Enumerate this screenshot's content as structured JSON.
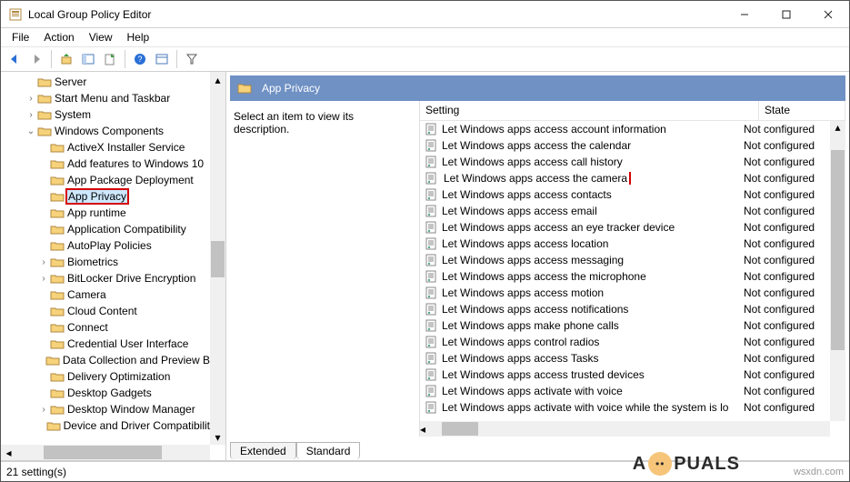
{
  "window": {
    "title": "Local Group Policy Editor"
  },
  "menu": {
    "file": "File",
    "action": "Action",
    "view": "View",
    "help": "Help"
  },
  "tree": {
    "items": [
      {
        "label": "Server",
        "depth": 2,
        "twisty": ""
      },
      {
        "label": "Start Menu and Taskbar",
        "depth": 2,
        "twisty": "›"
      },
      {
        "label": "System",
        "depth": 2,
        "twisty": "›"
      },
      {
        "label": "Windows Components",
        "depth": 2,
        "twisty": "v"
      },
      {
        "label": "ActiveX Installer Service",
        "depth": 3,
        "twisty": ""
      },
      {
        "label": "Add features to Windows 10",
        "depth": 3,
        "twisty": ""
      },
      {
        "label": "App Package Deployment",
        "depth": 3,
        "twisty": ""
      },
      {
        "label": "App Privacy",
        "depth": 3,
        "twisty": "",
        "selected": true,
        "redbox": true
      },
      {
        "label": "App runtime",
        "depth": 3,
        "twisty": ""
      },
      {
        "label": "Application Compatibility",
        "depth": 3,
        "twisty": ""
      },
      {
        "label": "AutoPlay Policies",
        "depth": 3,
        "twisty": ""
      },
      {
        "label": "Biometrics",
        "depth": 3,
        "twisty": "›"
      },
      {
        "label": "BitLocker Drive Encryption",
        "depth": 3,
        "twisty": "›"
      },
      {
        "label": "Camera",
        "depth": 3,
        "twisty": ""
      },
      {
        "label": "Cloud Content",
        "depth": 3,
        "twisty": ""
      },
      {
        "label": "Connect",
        "depth": 3,
        "twisty": ""
      },
      {
        "label": "Credential User Interface",
        "depth": 3,
        "twisty": ""
      },
      {
        "label": "Data Collection and Preview B",
        "depth": 3,
        "twisty": ""
      },
      {
        "label": "Delivery Optimization",
        "depth": 3,
        "twisty": ""
      },
      {
        "label": "Desktop Gadgets",
        "depth": 3,
        "twisty": ""
      },
      {
        "label": "Desktop Window Manager",
        "depth": 3,
        "twisty": "›"
      },
      {
        "label": "Device and Driver Compatibilit",
        "depth": 3,
        "twisty": ""
      }
    ]
  },
  "content": {
    "header": "App Privacy",
    "description": "Select an item to view its description.",
    "columns": {
      "setting": "Setting",
      "state": "State"
    },
    "rows": [
      {
        "label": "Let Windows apps access account information",
        "state": "Not configured"
      },
      {
        "label": "Let Windows apps access the calendar",
        "state": "Not configured"
      },
      {
        "label": "Let Windows apps access call history",
        "state": "Not configured"
      },
      {
        "label": "Let Windows apps access the camera",
        "state": "Not configured",
        "redbox": true
      },
      {
        "label": "Let Windows apps access contacts",
        "state": "Not configured"
      },
      {
        "label": "Let Windows apps access email",
        "state": "Not configured"
      },
      {
        "label": "Let Windows apps access an eye tracker device",
        "state": "Not configured"
      },
      {
        "label": "Let Windows apps access location",
        "state": "Not configured"
      },
      {
        "label": "Let Windows apps access messaging",
        "state": "Not configured"
      },
      {
        "label": "Let Windows apps access the microphone",
        "state": "Not configured"
      },
      {
        "label": "Let Windows apps access motion",
        "state": "Not configured"
      },
      {
        "label": "Let Windows apps access notifications",
        "state": "Not configured"
      },
      {
        "label": "Let Windows apps make phone calls",
        "state": "Not configured"
      },
      {
        "label": "Let Windows apps control radios",
        "state": "Not configured"
      },
      {
        "label": "Let Windows apps access Tasks",
        "state": "Not configured"
      },
      {
        "label": "Let Windows apps access trusted devices",
        "state": "Not configured"
      },
      {
        "label": "Let Windows apps activate with voice",
        "state": "Not configured"
      },
      {
        "label": "Let Windows apps activate with voice while the system is lo",
        "state": "Not configured"
      }
    ]
  },
  "tabs": {
    "extended": "Extended",
    "standard": "Standard"
  },
  "status": {
    "text": "21 setting(s)"
  },
  "watermark": "wsxdn.com",
  "logo": "A  PUALS"
}
